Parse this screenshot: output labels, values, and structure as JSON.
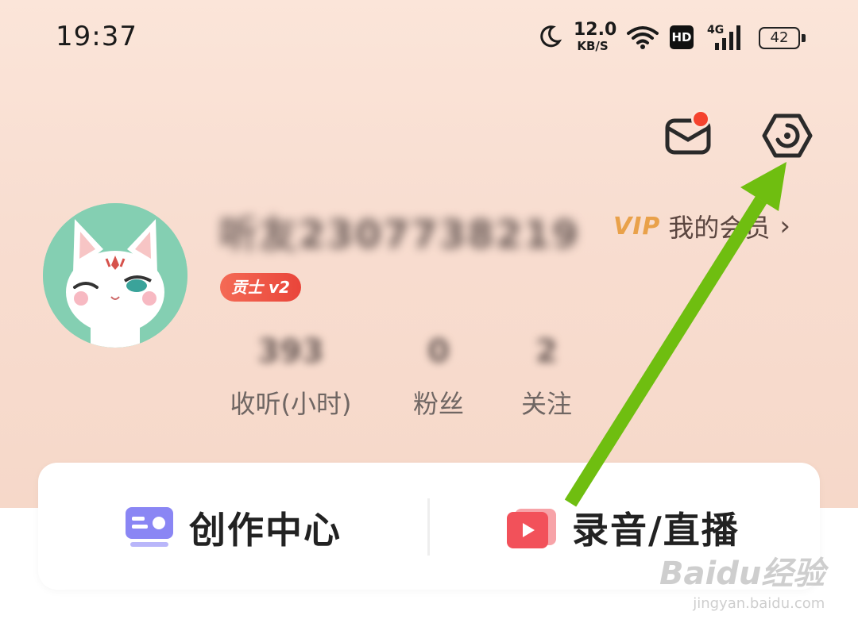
{
  "status_bar": {
    "time": "19:37",
    "net_speed_value": "12.0",
    "net_speed_unit": "KB/S",
    "hd_label": "HD",
    "network_label": "4G",
    "battery": "42"
  },
  "header": {
    "mail_icon": "mail-icon",
    "mail_has_notification": true,
    "settings_icon": "settings-icon"
  },
  "profile": {
    "username": "听友2307738219",
    "level_badge": "贡士 v2",
    "vip_word": "VIP",
    "vip_label": "我的会员",
    "vip_chevron": "›"
  },
  "stats": {
    "listen": {
      "value": "393",
      "label": "收听(小时)"
    },
    "fans": {
      "value": "0",
      "label": "粉丝"
    },
    "follow": {
      "value": "2",
      "label": "关注"
    }
  },
  "card": {
    "create_label": "创作中心",
    "record_label": "录音/直播"
  },
  "watermark": {
    "line1": "Baidu经验",
    "line2": "jingyan.baidu.com"
  },
  "colors": {
    "accent_vip": "#e9a14a",
    "badge": "#e9453a",
    "notification_dot": "#f5432e",
    "annotation_arrow": "#6fbe10",
    "create_icon": "#8a86f4",
    "record_icon": "#f2515a"
  }
}
